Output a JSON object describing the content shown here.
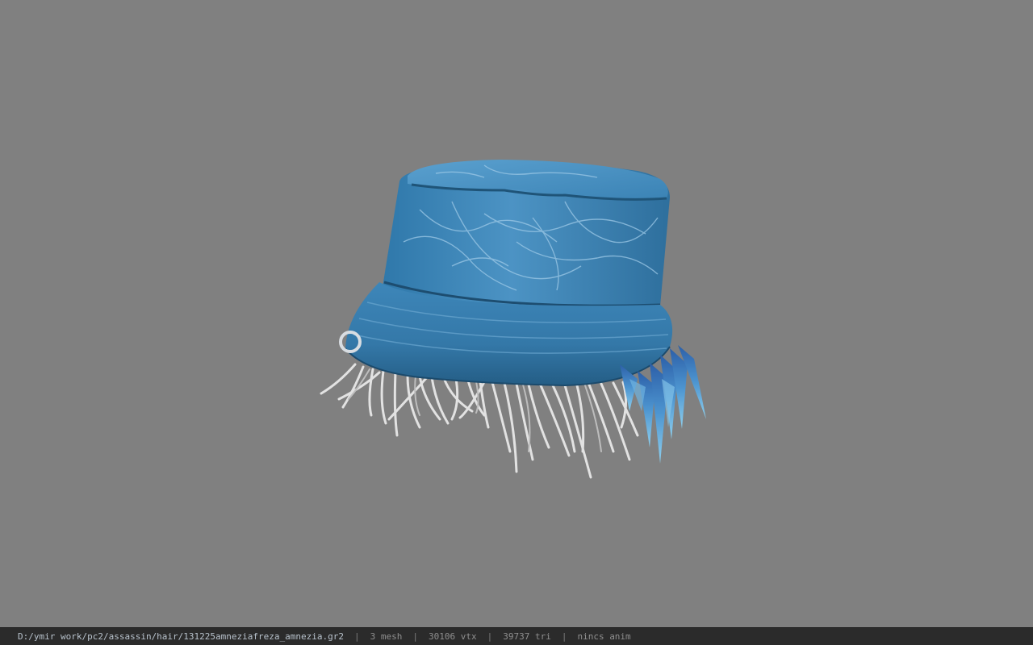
{
  "viewer": {
    "background_color": "#808080",
    "model_icon": "bucket-hat-with-hair-model"
  },
  "status_bar": {
    "file_path": "D:/ymir work/pc2/assassin/hair/131225amneziafreza_amnezia.gr2",
    "separator": "|",
    "mesh_count": "3 mesh",
    "vertex_count": "30106 vtx",
    "triangle_count": "39737 tri",
    "animation": "nincs anim"
  },
  "colors": {
    "hat_main": "#3f86b8",
    "hat_dark": "#2a6892",
    "hat_light": "#7fb5d8",
    "hair": "#e4e4e4",
    "crystal": "#3a7ec0",
    "status_bar_bg": "#2b2b2b"
  }
}
